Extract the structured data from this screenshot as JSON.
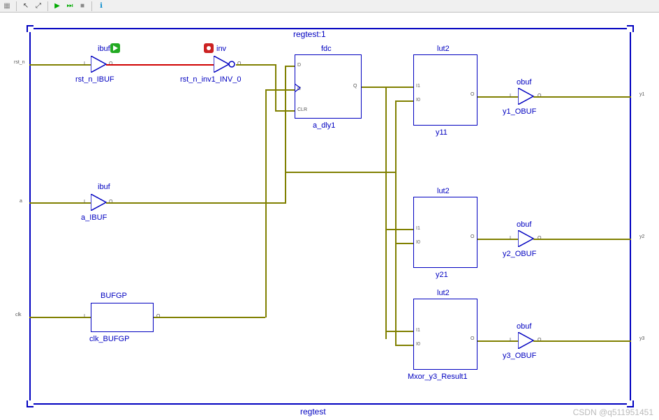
{
  "toolbar": {
    "items": [
      "grid",
      "sep",
      "cursor",
      "zoom",
      "sep",
      "play",
      "step",
      "stop",
      "sep",
      "info"
    ]
  },
  "top_title": "regtest:1",
  "bottom_title": "regtest",
  "ports_in": {
    "rst_n": "rst_n",
    "a": "a",
    "clk": "clk"
  },
  "ports_out": {
    "y1": "y1",
    "y2": "y2",
    "y3": "y3"
  },
  "blocks": {
    "ibuf1": {
      "type": "ibuf",
      "name": "rst_n_IBUF"
    },
    "inv1": {
      "type": "inv",
      "name": "rst_n_inv1_INV_0"
    },
    "fdc": {
      "type": "fdc",
      "name": "a_dly1",
      "pins": {
        "d": "D",
        "c": "C",
        "clr": "CLR",
        "q": "Q"
      }
    },
    "ibuf2": {
      "type": "ibuf",
      "name": "a_IBUF"
    },
    "bufgp": {
      "type": "BUFGP",
      "name": "clk_BUFGP"
    },
    "lut2a": {
      "type": "lut2",
      "name": "y11",
      "pins": {
        "i1": "I1",
        "i0": "I0",
        "o": "O"
      }
    },
    "lut2b": {
      "type": "lut2",
      "name": "y21",
      "pins": {
        "i1": "I1",
        "i0": "I0",
        "o": "O"
      }
    },
    "lut2c": {
      "type": "lut2",
      "name": "Mxor_y3_Result1",
      "pins": {
        "i1": "I1",
        "i0": "I0",
        "o": "O"
      }
    },
    "obuf1": {
      "type": "obuf",
      "name": "y1_OBUF"
    },
    "obuf2": {
      "type": "obuf",
      "name": "y2_OBUF"
    },
    "obuf3": {
      "type": "obuf",
      "name": "y3_OBUF"
    }
  },
  "pin_text": {
    "o": "O",
    "i": "I"
  },
  "watermark": "CSDN @q511951451"
}
